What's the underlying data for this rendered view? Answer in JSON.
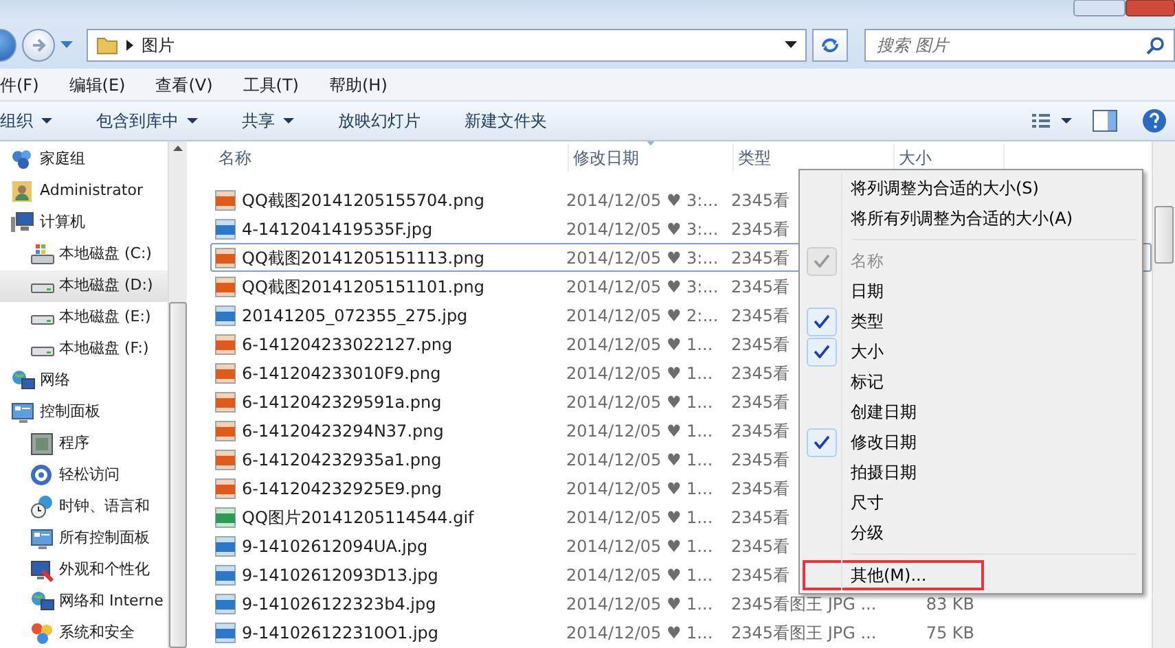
{
  "address_bar": {
    "path": "图片",
    "search_placeholder": "搜索 图片"
  },
  "menu_bar": [
    "件(F)",
    "编辑(E)",
    "查看(V)",
    "工具(T)",
    "帮助(H)"
  ],
  "toolbar": [
    {
      "label": "组织",
      "dropdown": true
    },
    {
      "label": "包含到库中",
      "dropdown": true
    },
    {
      "label": "共享",
      "dropdown": true
    },
    {
      "label": "放映幻灯片",
      "dropdown": false
    },
    {
      "label": "新建文件夹",
      "dropdown": false
    }
  ],
  "sidebar": {
    "items": [
      {
        "label": "家庭组",
        "selected": false
      },
      {
        "label": "Administrator",
        "selected": false
      },
      {
        "label": "计算机",
        "selected": false,
        "children": [
          {
            "label": "本地磁盘 (C:)",
            "selected": false
          },
          {
            "label": "本地磁盘 (D:)",
            "selected": true
          },
          {
            "label": "本地磁盘 (E:)",
            "selected": false
          },
          {
            "label": "本地磁盘 (F:)",
            "selected": false
          }
        ]
      },
      {
        "label": "网络",
        "selected": false
      },
      {
        "label": "控制面板",
        "selected": false,
        "children": [
          {
            "label": "程序",
            "selected": false
          },
          {
            "label": "轻松访问",
            "selected": false
          },
          {
            "label": "时钟、语言和",
            "selected": false
          },
          {
            "label": "所有控制面板",
            "selected": false
          },
          {
            "label": "外观和个性化",
            "selected": false
          },
          {
            "label": "网络和 Interne",
            "selected": false
          },
          {
            "label": "系统和安全",
            "selected": false
          }
        ]
      }
    ]
  },
  "file_list": {
    "columns": [
      {
        "label": "名称",
        "sorted": false
      },
      {
        "label": "修改日期",
        "sorted": true
      },
      {
        "label": "类型",
        "sorted": false
      },
      {
        "label": "大小",
        "sorted": false
      }
    ],
    "rows": [
      {
        "kind": "png",
        "name": "QQ截图20141205155704.png",
        "date": "2014/12/05 ♥ 3:...",
        "type": "2345看",
        "focused": false
      },
      {
        "kind": "jpg",
        "name": "4-1412041419535F.jpg",
        "date": "2014/12/05 ♥ 3:...",
        "type": "2345看",
        "focused": false
      },
      {
        "kind": "png",
        "name": "QQ截图20141205151113.png",
        "date": "2014/12/05 ♥ 3:...",
        "type": "2345看",
        "focused": true
      },
      {
        "kind": "png",
        "name": "QQ截图20141205151101.png",
        "date": "2014/12/05 ♥ 3:...",
        "type": "2345看",
        "focused": false
      },
      {
        "kind": "jpg",
        "name": "20141205_072355_275.jpg",
        "date": "2014/12/05 ♥ 2:...",
        "type": "2345看",
        "focused": false
      },
      {
        "kind": "png",
        "name": "6-141204233022127.png",
        "date": "2014/12/05 ♥ 1...",
        "type": "2345看",
        "focused": false
      },
      {
        "kind": "png",
        "name": "6-141204233010F9.png",
        "date": "2014/12/05 ♥ 1...",
        "type": "2345看",
        "focused": false
      },
      {
        "kind": "png",
        "name": "6-1412042329591a.png",
        "date": "2014/12/05 ♥ 1...",
        "type": "2345看",
        "focused": false
      },
      {
        "kind": "png",
        "name": "6-14120423294N37.png",
        "date": "2014/12/05 ♥ 1...",
        "type": "2345看",
        "focused": false
      },
      {
        "kind": "png",
        "name": "6-141204232935a1.png",
        "date": "2014/12/05 ♥ 1...",
        "type": "2345看",
        "focused": false
      },
      {
        "kind": "png",
        "name": "6-141204232925E9.png",
        "date": "2014/12/05 ♥ 1...",
        "type": "2345看",
        "focused": false
      },
      {
        "kind": "gif",
        "name": "QQ图片20141205114544.gif",
        "date": "2014/12/05 ♥ 1...",
        "type": "2345看",
        "focused": false
      },
      {
        "kind": "jpg",
        "name": "9-14102612094UA.jpg",
        "date": "2014/12/05 ♥ 1...",
        "type": "2345看",
        "focused": false
      },
      {
        "kind": "jpg",
        "name": "9-14102612093D13.jpg",
        "date": "2014/12/05 ♥ 1...",
        "type": "2345看",
        "focused": false
      },
      {
        "kind": "jpg",
        "name": "9-141026122323b4.jpg",
        "date": "2014/12/05 ♥ 1...",
        "type": "2345看图王 JPG ...",
        "size": "83 KB",
        "focused": false
      },
      {
        "kind": "jpg",
        "name": "9-141026122310O1.jpg",
        "date": "2014/12/05 ♥ 1...",
        "type": "2345看图王 JPG ...",
        "size": "75 KB",
        "focused": false
      }
    ]
  },
  "context_menu": {
    "items": [
      {
        "kind": "command",
        "label": "将列调整为合适的大小(S)"
      },
      {
        "kind": "command",
        "label": "将所有列调整为合适的大小(A)"
      },
      {
        "kind": "separator"
      },
      {
        "kind": "column",
        "label": "名称",
        "checked": true,
        "disabled": true
      },
      {
        "kind": "column",
        "label": "日期",
        "checked": false,
        "disabled": false
      },
      {
        "kind": "column",
        "label": "类型",
        "checked": true,
        "disabled": false
      },
      {
        "kind": "column",
        "label": "大小",
        "checked": true,
        "disabled": false
      },
      {
        "kind": "column",
        "label": "标记",
        "checked": false,
        "disabled": false
      },
      {
        "kind": "column",
        "label": "创建日期",
        "checked": false,
        "disabled": false
      },
      {
        "kind": "column",
        "label": "修改日期",
        "checked": true,
        "disabled": false
      },
      {
        "kind": "column",
        "label": "拍摄日期",
        "checked": false,
        "disabled": false
      },
      {
        "kind": "column",
        "label": "尺寸",
        "checked": false,
        "disabled": false
      },
      {
        "kind": "column",
        "label": "分级",
        "checked": false,
        "disabled": false
      },
      {
        "kind": "separator"
      },
      {
        "kind": "command",
        "label": "其他(M)...",
        "highlighted": true
      }
    ]
  }
}
